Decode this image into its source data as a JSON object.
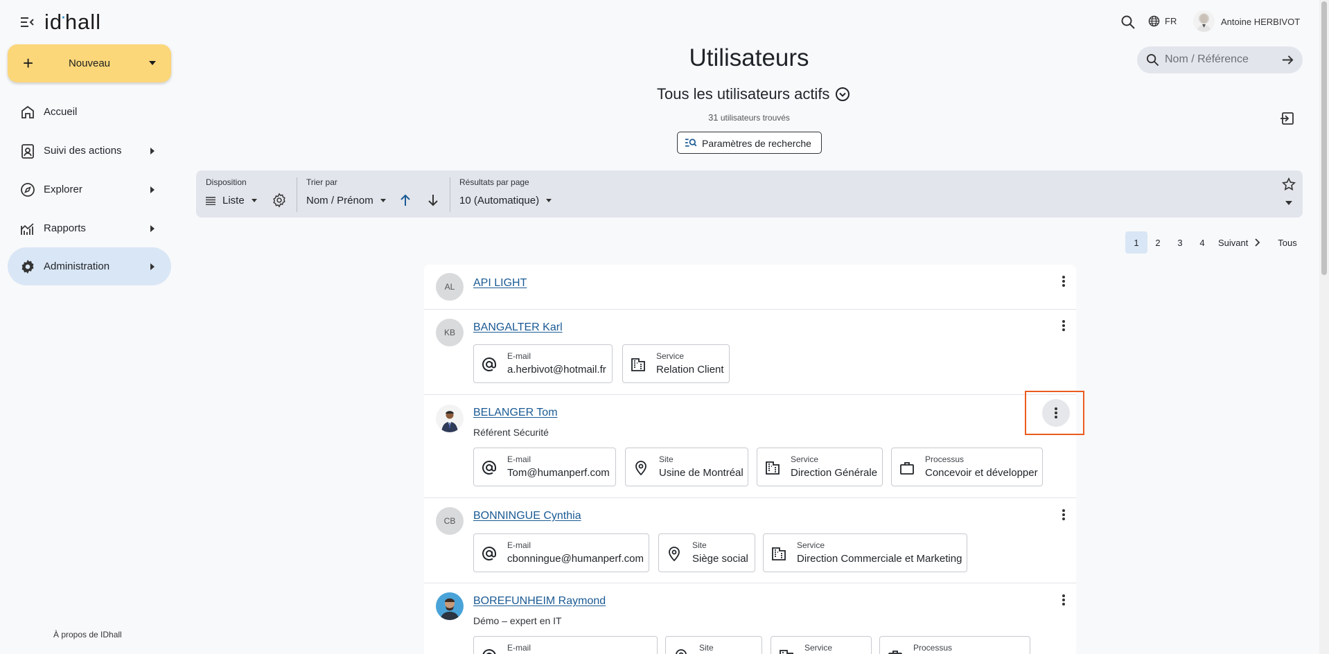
{
  "app": {
    "logo_text_before": "id",
    "logo_dot": "·",
    "logo_text_after": "hall",
    "new_button_label": "Nouveau",
    "about_link": "À propos de IDhall"
  },
  "sidebar": {
    "items": [
      {
        "label": "Accueil",
        "icon": "home-icon",
        "has_submenu": false
      },
      {
        "label": "Suivi des actions",
        "icon": "clipboard-user-icon",
        "has_submenu": true
      },
      {
        "label": "Explorer",
        "icon": "compass-icon",
        "has_submenu": true
      },
      {
        "label": "Rapports",
        "icon": "chart-icon",
        "has_submenu": true
      },
      {
        "label": "Administration",
        "icon": "gear-icon",
        "has_submenu": true,
        "active": true
      }
    ]
  },
  "topbar": {
    "language": "FR",
    "user_name": "Antoine HERBIVOT",
    "quick_search_placeholder": "Nom / Référence"
  },
  "header": {
    "title": "Utilisateurs",
    "filter_name": "Tous les utilisateurs actifs",
    "result_count": "31",
    "result_suffix": "utilisateurs trouvés",
    "search_params_label": "Paramètres de recherche"
  },
  "toolbar": {
    "disposition_caption": "Disposition",
    "disposition_value": "Liste",
    "sort_caption": "Trier par",
    "sort_value": "Nom / Prénom",
    "per_page_caption": "Résultats par page",
    "per_page_value": "10 (Automatique)"
  },
  "pagination": {
    "pages": [
      "1",
      "2",
      "3",
      "4"
    ],
    "current": "1",
    "next_label": "Suivant",
    "all_label": "Tous"
  },
  "users": [
    {
      "initials": "AL",
      "name": "API LIGHT",
      "role": "",
      "fields": []
    },
    {
      "initials": "KB",
      "name": "BANGALTER Karl",
      "role": "",
      "fields": [
        {
          "caption": "E-mail",
          "value": "a.herbivot@hotmail.fr",
          "icon": "at-icon"
        },
        {
          "caption": "Service",
          "value": "Relation Client",
          "icon": "building-icon"
        }
      ]
    },
    {
      "initials": "",
      "name": "BELANGER Tom",
      "role": "Référent Sécurité",
      "fields": [
        {
          "caption": "E-mail",
          "value": "Tom@humanperf.com",
          "icon": "at-icon"
        },
        {
          "caption": "Site",
          "value": "Usine de Montréal",
          "icon": "location-pin-icon"
        },
        {
          "caption": "Service",
          "value": "Direction Générale",
          "icon": "building-icon"
        },
        {
          "caption": "Processus",
          "value": "Concevoir et développer",
          "icon": "briefcase-icon"
        }
      ]
    },
    {
      "initials": "CB",
      "name": "BONNINGUE Cynthia",
      "role": "",
      "fields": [
        {
          "caption": "E-mail",
          "value": "cbonningue@humanperf.com",
          "icon": "at-icon"
        },
        {
          "caption": "Site",
          "value": "Siège social",
          "icon": "location-pin-icon"
        },
        {
          "caption": "Service",
          "value": "Direction Commerciale et Marketing",
          "icon": "building-icon"
        }
      ]
    },
    {
      "initials": "",
      "name": "BOREFUNHEIM Raymond",
      "role": "Démo – expert en IT",
      "fields": [
        {
          "caption": "E-mail",
          "value": "",
          "icon": "at-icon"
        },
        {
          "caption": "Site",
          "value": "",
          "icon": "location-pin-icon"
        },
        {
          "caption": "Service",
          "value": "",
          "icon": "building-icon"
        },
        {
          "caption": "Processus",
          "value": "",
          "icon": "briefcase-icon"
        }
      ]
    }
  ],
  "colors": {
    "accent_yellow": "#fbd77a",
    "active_nav": "#d9e6f5",
    "link_blue": "#1a5a94",
    "highlight_orange": "#ea5b1e",
    "toolbar_bg": "#e2e5ec"
  }
}
